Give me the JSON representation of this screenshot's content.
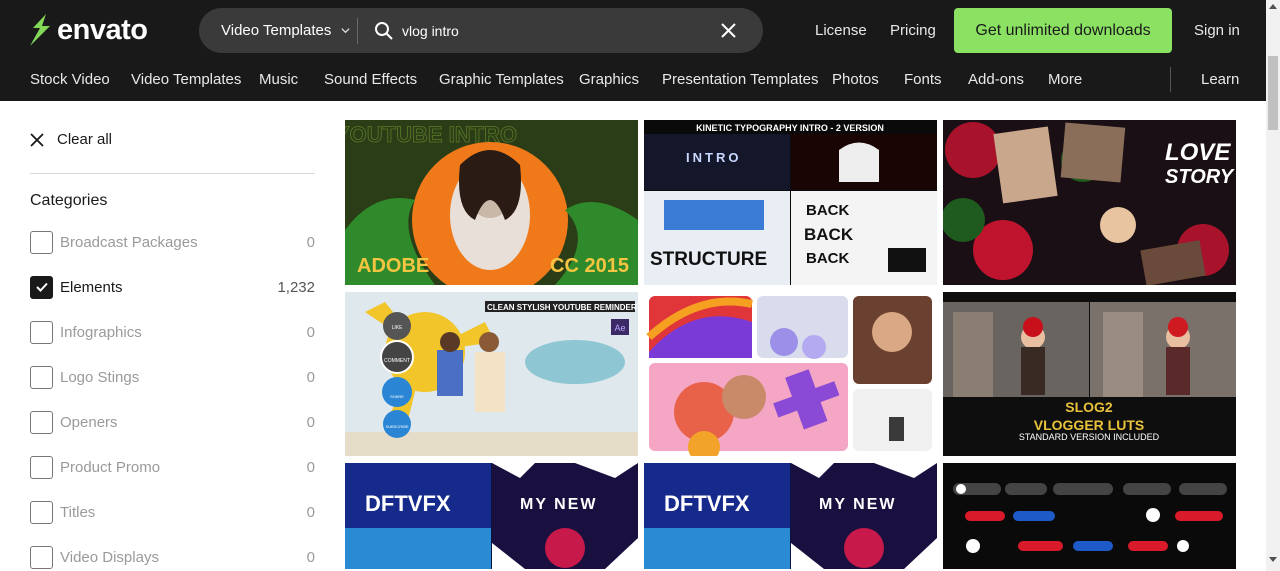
{
  "brand": {
    "name": "envato",
    "accent": "#8be262",
    "header_bg": "#191919"
  },
  "search": {
    "category": "Video Templates",
    "query": "vlog intro",
    "icon": "search-icon"
  },
  "header_links": {
    "license": "License",
    "pricing": "Pricing",
    "cta": "Get unlimited downloads",
    "signin": "Sign in"
  },
  "nav": [
    "Stock Video",
    "Video Templates",
    "Music",
    "Sound Effects",
    "Graphic Templates",
    "Graphics",
    "Presentation Templates",
    "Photos",
    "Fonts",
    "Add-ons",
    "More",
    "Learn"
  ],
  "sidebar": {
    "clear_all": "Clear all",
    "categories_title": "Categories",
    "categories": [
      {
        "label": "Broadcast Packages",
        "count": "0",
        "checked": false
      },
      {
        "label": "Elements",
        "count": "1,232",
        "checked": true
      },
      {
        "label": "Infographics",
        "count": "0",
        "checked": false
      },
      {
        "label": "Logo Stings",
        "count": "0",
        "checked": false
      },
      {
        "label": "Openers",
        "count": "0",
        "checked": false
      },
      {
        "label": "Product Promo",
        "count": "0",
        "checked": false
      },
      {
        "label": "Titles",
        "count": "0",
        "checked": false
      },
      {
        "label": "Video Displays",
        "count": "0",
        "checked": false
      }
    ]
  },
  "results": [
    {
      "texts": {
        "t1": "ADOBE",
        "t2": "CC 2015",
        "bg": "YOUTUBE INTRO"
      }
    },
    {
      "texts": {
        "title": "KINETIC TYPOGRAPHY INTRO - 2 VERSION",
        "a": "INTRO",
        "b": "STRUCTURE",
        "c": "BACK"
      }
    },
    {
      "texts": {
        "a": "LOVE",
        "b": "STORY"
      }
    },
    {
      "texts": {
        "title": "CLEAN STYLISH YOUTUBE REMINDER",
        "like": "LIKE",
        "comment": "COMMENT",
        "share": "SHARE",
        "subscribe": "SUBSCRIBE"
      }
    },
    {
      "texts": {}
    },
    {
      "texts": {
        "a": "SLOG2",
        "b": "VLOGGER LUTS",
        "c": "STANDARD VERSION INCLUDED"
      }
    },
    {
      "texts": {
        "a": "DFTVFX",
        "b": "MY NEW"
      }
    },
    {
      "texts": {
        "a": "DFTVFX",
        "b": "MY NEW"
      }
    },
    {
      "texts": {}
    }
  ]
}
